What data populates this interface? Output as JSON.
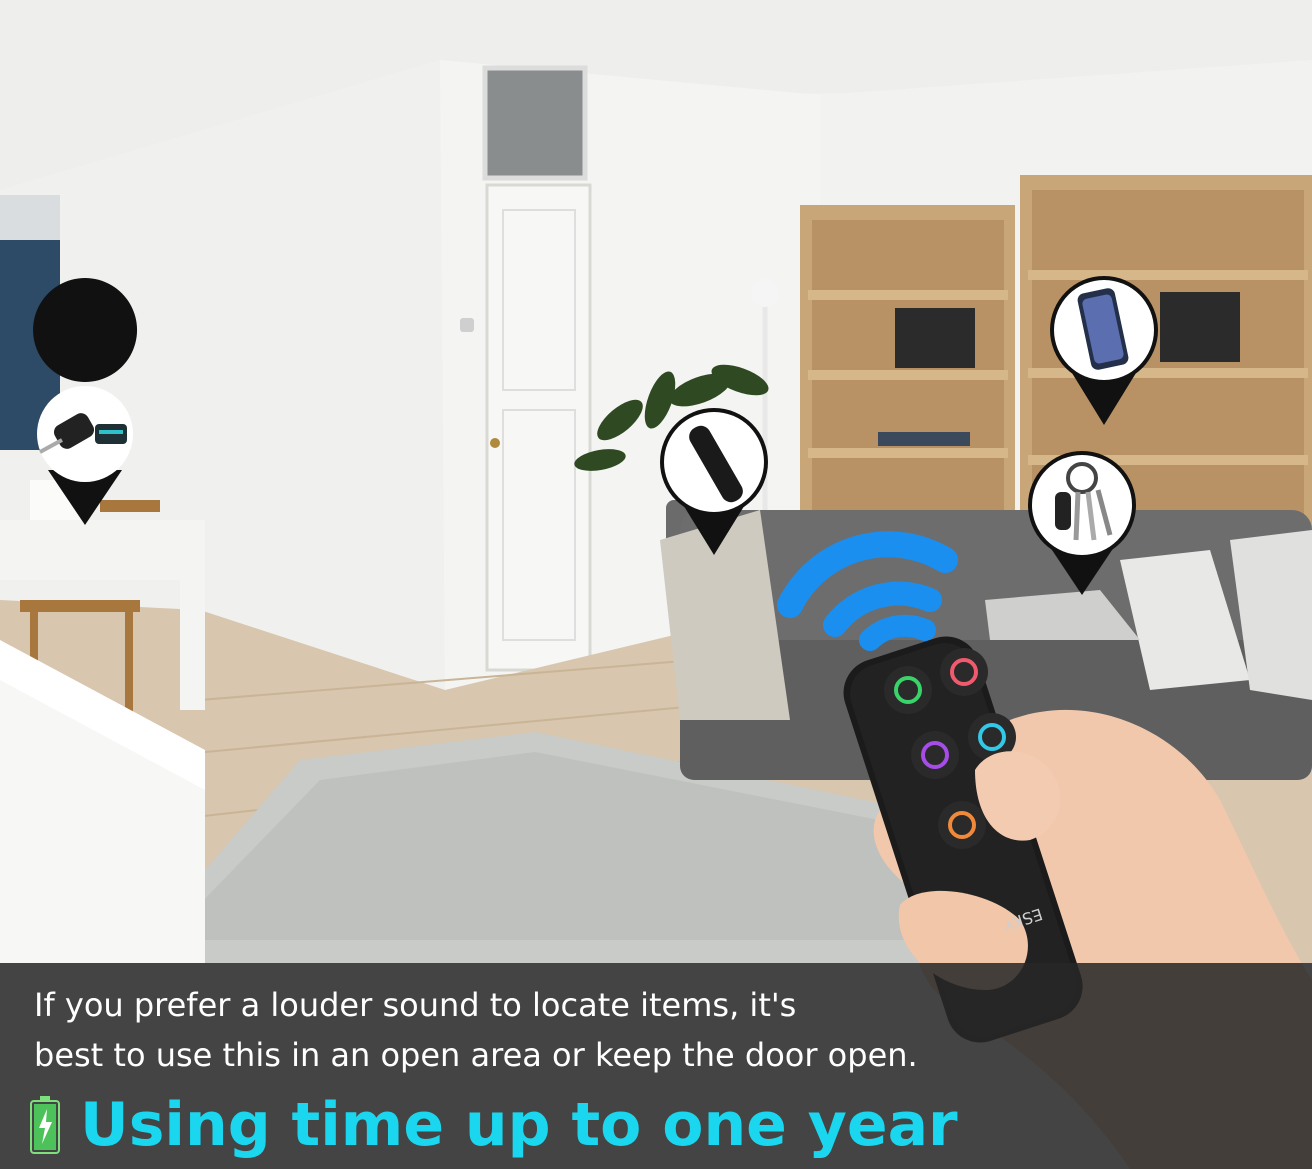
{
  "caption": {
    "line1": "If you prefer a louder sound to locate items, it's",
    "line2": "best to use this in an open area or keep the door open.",
    "headline": "Using time up to one year"
  },
  "remote": {
    "brand": "ESKY"
  },
  "colors": {
    "headline": "#1ad7ef",
    "caption_bg": "#282828",
    "signal": "#1a8ff0",
    "button_green": "#3ad36a",
    "button_red": "#f05a6e",
    "button_purple": "#a64de8",
    "button_cyan": "#33c8e8",
    "button_orange": "#f08a3a"
  },
  "pins": [
    {
      "icon": "car-key-icon"
    },
    {
      "icon": "tv-remote-icon"
    },
    {
      "icon": "smartphone-icon"
    },
    {
      "icon": "keys-icon"
    }
  ]
}
